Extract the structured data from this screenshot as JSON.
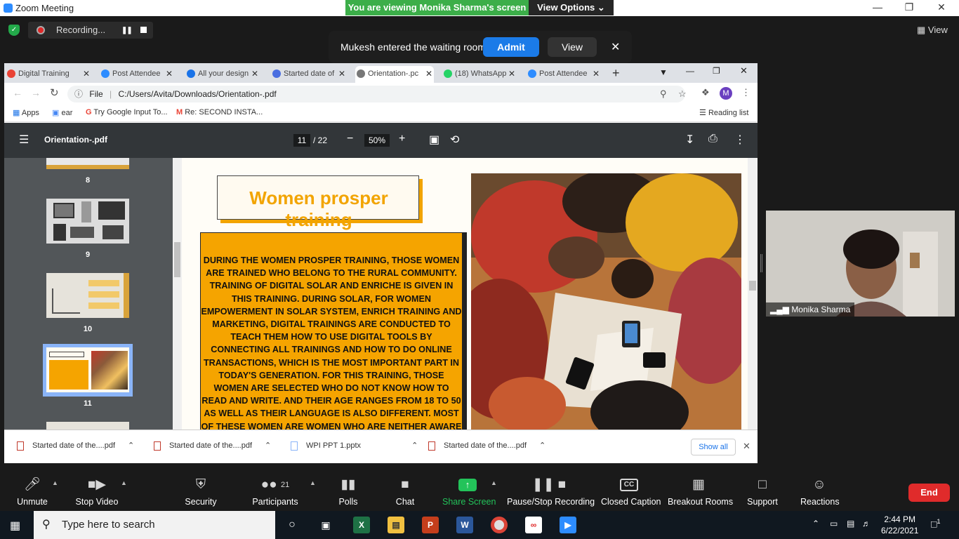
{
  "zoom_window": {
    "title": "Zoom Meeting",
    "viewing_banner": "You are viewing Monika Sharma's screen",
    "view_options": "View Options",
    "view_label": "View"
  },
  "recording": {
    "label": "Recording..."
  },
  "waiting_room": {
    "message": "Mukesh entered the waiting room",
    "admit": "Admit",
    "view": "View"
  },
  "browser": {
    "tabs": [
      {
        "label": "Digital Training",
        "icon_color": "#ea4335"
      },
      {
        "label": "Post Attendee",
        "icon_color": "#2d8cff"
      },
      {
        "label": "All your design",
        "icon_color": "#1a73e8"
      },
      {
        "label": "Started date of",
        "icon_color": "#4a6ee0"
      },
      {
        "label": "Orientation-.pc",
        "icon_color": "#777777"
      },
      {
        "label": "(18) WhatsApp",
        "icon_color": "#25d366"
      },
      {
        "label": "Post Attendee",
        "icon_color": "#2d8cff"
      }
    ],
    "address": {
      "scheme": "File",
      "url": "C:/Users/Avita/Downloads/Orientation-.pdf"
    },
    "profile_initial": "M",
    "bookmarks": [
      "Apps",
      "ear",
      "Try Google Input To...",
      "Re: SECOND INSTA..."
    ],
    "reading_list": "Reading list"
  },
  "pdf": {
    "filename": "Orientation-.pdf",
    "current_page": "11",
    "total_pages": "/ 22",
    "zoom": "50%",
    "thumbnails": [
      "8",
      "9",
      "10",
      "11"
    ],
    "slide_title": "Women prosper training",
    "slide_body": "DURING THE WOMEN PROSPER TRAINING, THOSE WOMEN ARE TRAINED WHO BELONG TO THE RURAL COMMUNITY. TRAINING OF DIGITAL SOLAR AND ENRICHE IS GIVEN IN THIS TRAINING. DURING SOLAR, FOR WOMEN EMPOWERMENT IN SOLAR SYSTEM, ENRICH TRAINING AND MARKETING, DIGITAL TRAININGS ARE CONDUCTED  TO TEACH THEM HOW TO USE DIGITAL TOOLS BY CONNECTING ALL TRAININGS AND HOW TO DO ONLINE TRANSACTIONS, WHICH IS THE MOST IMPORTANT PART IN TODAY'S GENERATION. FOR THIS TRAINING, THOSE WOMEN ARE SELECTED WHO DO NOT KNOW HOW TO READ AND WRITE. AND THEIR AGE RANGES FROM 18 TO 50 AS WELL AS THEIR LANGUAGE IS ALSO DIFFERENT.  MOST OF THESE WOMEN ARE WOMEN WHO ARE NEITHER AWARE OF DIGITAL TOOLS NOR HAVE EVER USED"
  },
  "downloads": {
    "items": [
      "Started date of the....pdf",
      "Started date of the....pdf",
      "WPI PPT 1.pptx",
      "Started date of the....pdf"
    ],
    "show_all": "Show all"
  },
  "participant": {
    "name": "Monika Sharma"
  },
  "toolbar": {
    "unmute": "Unmute",
    "stop_video": "Stop Video",
    "security": "Security",
    "participants": "Participants",
    "participants_count": "21",
    "polls": "Polls",
    "chat": "Chat",
    "share_screen": "Share Screen",
    "pause_recording": "Pause/Stop Recording",
    "closed_caption": "Closed Caption",
    "closed_caption_badge": "CC",
    "breakout_rooms": "Breakout Rooms",
    "support": "Support",
    "reactions": "Reactions",
    "end": "End"
  },
  "taskbar": {
    "search_placeholder": "Type here to search",
    "time": "2:44 PM",
    "date": "6/22/2021",
    "notification_count": "1"
  }
}
